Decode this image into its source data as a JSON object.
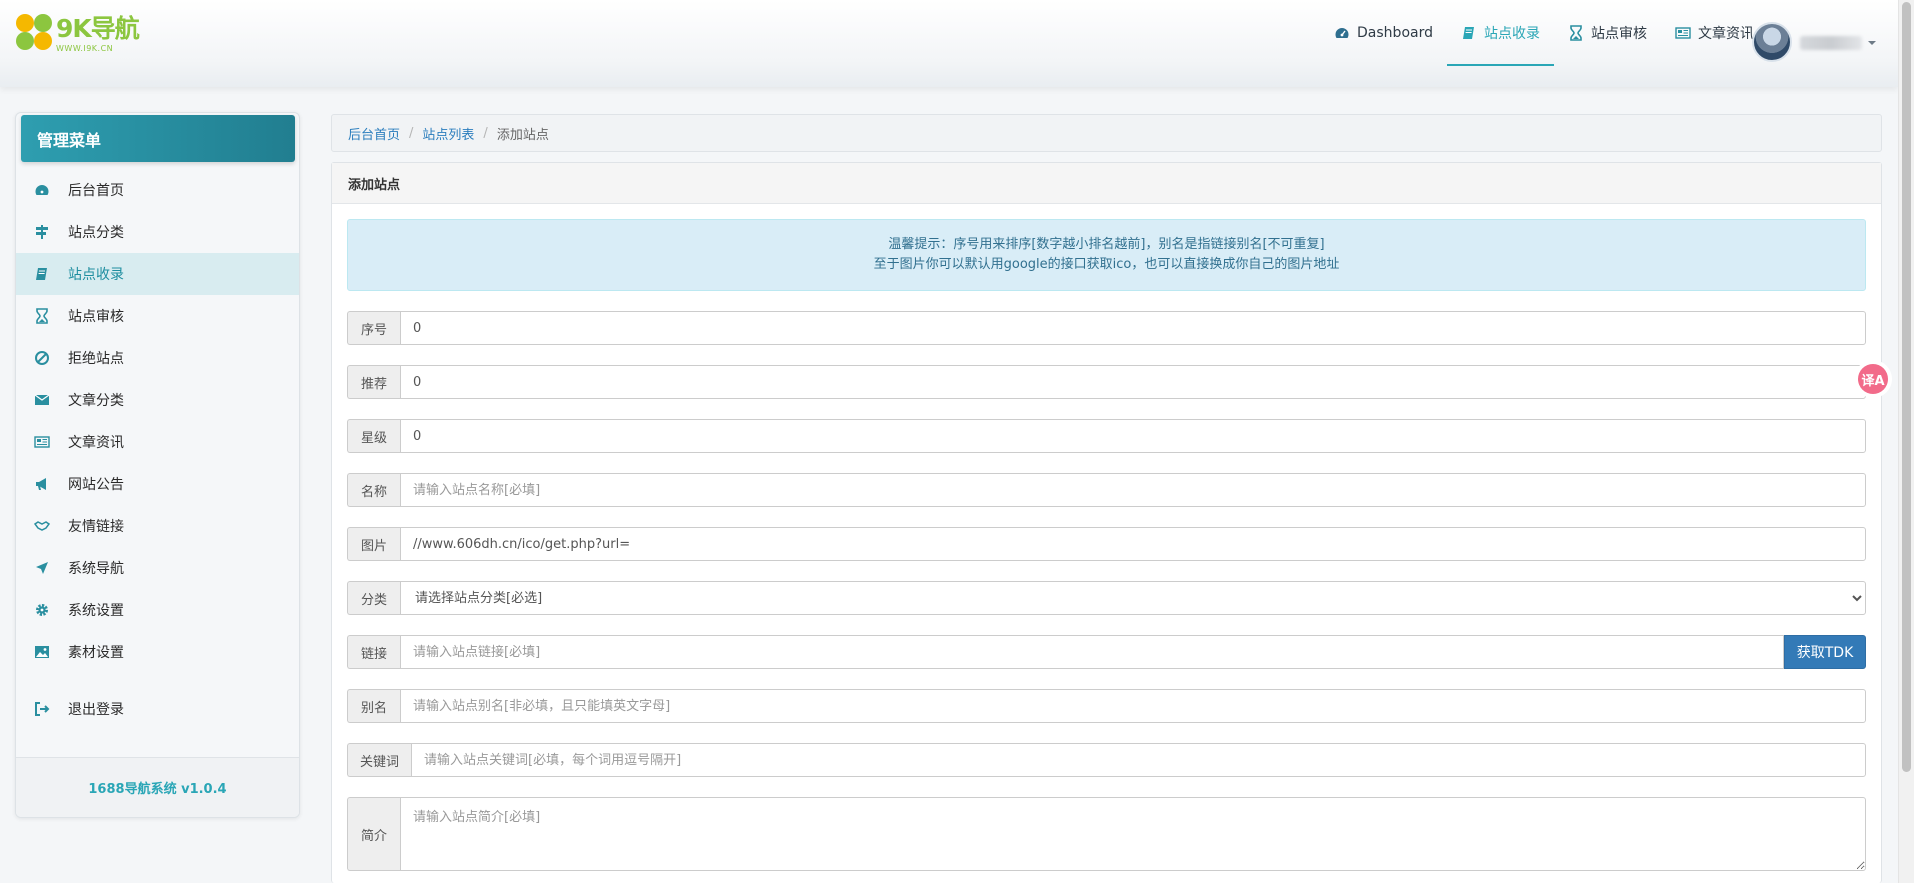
{
  "logo": {
    "text": "9K导航",
    "sub": "WWW.I9K.CN"
  },
  "topnav": [
    {
      "label": "Dashboard",
      "icon": "dashboard-icon",
      "active": false
    },
    {
      "label": "站点收录",
      "icon": "book-icon",
      "active": true
    },
    {
      "label": "站点审核",
      "icon": "hourglass-icon",
      "active": false
    },
    {
      "label": "文章资讯",
      "icon": "newspaper-icon",
      "active": false
    }
  ],
  "translate_glyph": "译A",
  "sidebar": {
    "title": "管理菜单",
    "items": [
      {
        "label": "后台首页",
        "icon": "dashboard-icon"
      },
      {
        "label": "站点分类",
        "icon": "signpost-icon"
      },
      {
        "label": "站点收录",
        "icon": "book-icon",
        "active": true
      },
      {
        "label": "站点审核",
        "icon": "hourglass-icon"
      },
      {
        "label": "拒绝站点",
        "icon": "ban-icon"
      },
      {
        "label": "文章分类",
        "icon": "envelope-icon"
      },
      {
        "label": "文章资讯",
        "icon": "newspaper-icon"
      },
      {
        "label": "网站公告",
        "icon": "bullhorn-icon"
      },
      {
        "label": "友情链接",
        "icon": "handshake-icon"
      },
      {
        "label": "系统导航",
        "icon": "location-arrow-icon"
      },
      {
        "label": "系统设置",
        "icon": "gear-icon"
      },
      {
        "label": "素材设置",
        "icon": "image-icon"
      }
    ],
    "logout": {
      "label": "退出登录",
      "icon": "sign-out-icon"
    },
    "footer": "1688导航系统 v1.0.4"
  },
  "breadcrumb": {
    "home": "后台首页",
    "list": "站点列表",
    "current": "添加站点"
  },
  "panel": {
    "title": "添加站点",
    "alert_line1": "温馨提示：序号用来排序[数字越小排名越前]，别名是指链接别名[不可重复]",
    "alert_line2": "至于图片你可以默认用google的接口获取ico，也可以直接换成你自己的图片地址"
  },
  "form": {
    "order": {
      "label": "序号",
      "value": "0"
    },
    "recommend": {
      "label": "推荐",
      "value": "0"
    },
    "stars": {
      "label": "星级",
      "value": "0"
    },
    "name": {
      "label": "名称",
      "value": "",
      "placeholder": "请输入站点名称[必填]"
    },
    "image": {
      "label": "图片",
      "value": "//www.606dh.cn/ico/get.php?url="
    },
    "category": {
      "label": "分类",
      "selected": "请选择站点分类[必选]"
    },
    "link": {
      "label": "链接",
      "placeholder": "请输入站点链接[必填]",
      "button": "获取TDK"
    },
    "alias": {
      "label": "别名",
      "placeholder": "请输入站点别名[非必填，且只能填英文字母]"
    },
    "keywords": {
      "label": "关键词",
      "placeholder": "请输入站点关键词[必填，每个词用逗号隔开]"
    },
    "intro": {
      "label": "简介",
      "placeholder": "请输入站点简介[必填]"
    }
  },
  "colors": {
    "accent": "#2aa6b6",
    "sidebar_head": "#2e9eb0",
    "primary_button": "#337ab7",
    "alert_bg": "#d9edf7"
  }
}
